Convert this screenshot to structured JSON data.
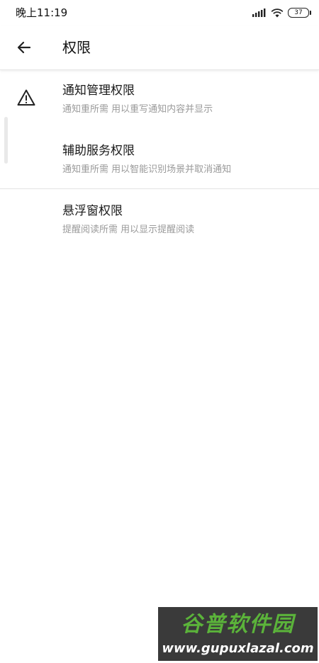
{
  "status_bar": {
    "time": "晚上11:19",
    "battery": "37",
    "signal_icon": "signal-bars-icon",
    "wifi_icon": "wifi-icon"
  },
  "app_bar": {
    "back_icon": "arrow-left-icon",
    "title": "权限"
  },
  "permissions": [
    {
      "title": "通知管理权限",
      "description": "通知重所需 用以重写通知内容并显示",
      "icon": "warning-icon"
    },
    {
      "title": "辅助服务权限",
      "description": "通知重所需 用以智能识别场景并取消通知"
    },
    {
      "title": "悬浮窗权限",
      "description": "提醒阅读所需 用以显示提醒阅读"
    }
  ],
  "watermark": {
    "name": "谷普软件园",
    "url": "www.gupuxlazal.com"
  }
}
